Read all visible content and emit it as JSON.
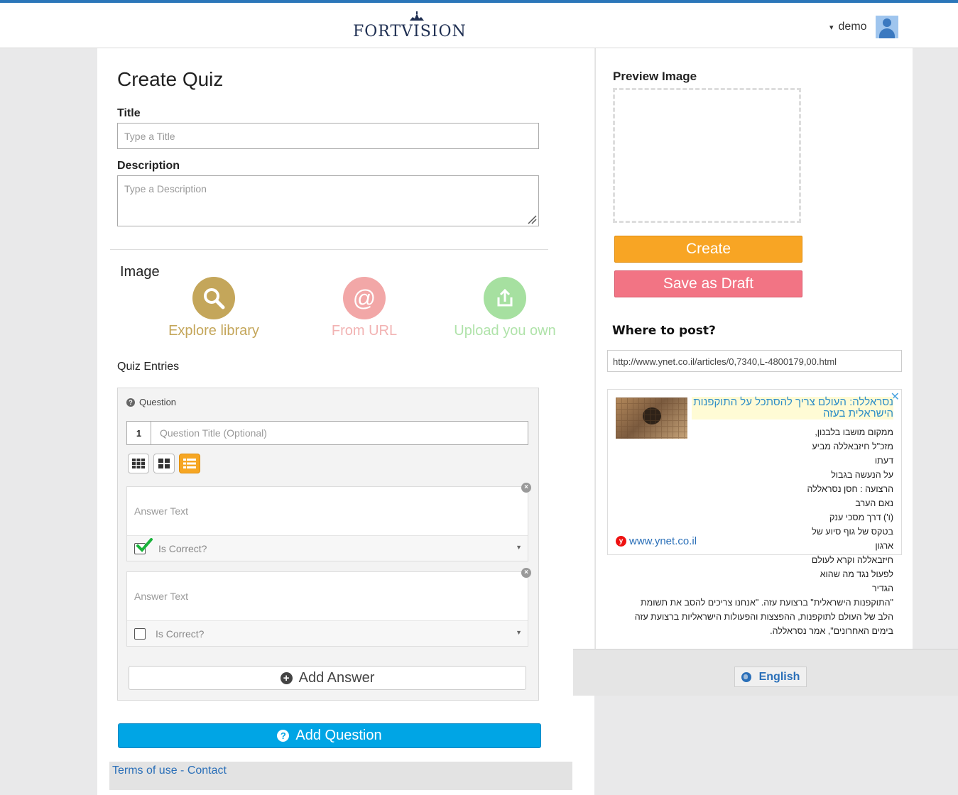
{
  "header": {
    "logo_text": "FORTVISION",
    "user_name": "demo",
    "user_caret": "▾"
  },
  "form": {
    "page_title": "Create Quiz",
    "title_label": "Title",
    "title_placeholder": "Type a Title",
    "description_label": "Description",
    "description_placeholder": "Type a Description",
    "image_label": "Image",
    "image_sources": [
      {
        "label": "Explore library",
        "icon": "search-icon",
        "color": "#c4a65a"
      },
      {
        "label": "From URL",
        "icon": "at-icon",
        "color": "#f2a7a7"
      },
      {
        "label": "Upload you own",
        "icon": "upload-icon",
        "color": "#a6e0a0"
      }
    ],
    "entries_label": "Quiz Entries"
  },
  "quiz": {
    "question_header": "Question",
    "question_number": "1",
    "question_placeholder": "Question Title (Optional)",
    "answers": [
      {
        "placeholder": "Answer Text",
        "correct_label": "Is Correct?",
        "checked": true
      },
      {
        "placeholder": "Answer Text",
        "correct_label": "Is Correct?",
        "checked": false
      }
    ],
    "add_answer_label": "Add Answer",
    "add_question_label": "Add Question"
  },
  "footer": {
    "terms_label": "Terms of use",
    "separator": "-",
    "contact_label": "Contact"
  },
  "sidebar": {
    "preview_label": "Preview Image",
    "create_label": "Create",
    "draft_label": "Save as Draft",
    "where_label": "Where to post?",
    "url_value": "http://www.ynet.co.il/articles/0,7340,L-4800179,00.html",
    "close_glyph": "✕",
    "article": {
      "headline": "נסראללה: העולם צריך להסתכל על התוקפנות הישראלית בעזה",
      "body_lines": [
        "ממקום מושבו בלבנון, מזכ\"ל חיזבאללה מביע דעתו",
        "על הנעשה בגבול הרצועה : חסן נסראללה נאם הערב",
        "(ו') דרך מסכי ענק בטקס של גוף סיוע של ארגון",
        "חיזבאללה וקרא לעולם לפעול נגד מה שהוא הגדיר",
        "\"התוקפנות הישראלית\" ברצועת עזה. \"אנחנו צריכים להסב את תשומת",
        "הלב של העולם לתוקפנות, ההפצצות והפעולות הישראליות ברצועת עזה",
        "בימים האחרונים\", אמר נסראללה."
      ],
      "source": "www.ynet.co.il",
      "source_badge": "y"
    }
  },
  "language": {
    "label": "English"
  },
  "colors": {
    "accent_blue": "#00a5e5",
    "create_orange": "#f8a524",
    "draft_pink": "#f27484",
    "link_blue": "#2a6fb8"
  }
}
